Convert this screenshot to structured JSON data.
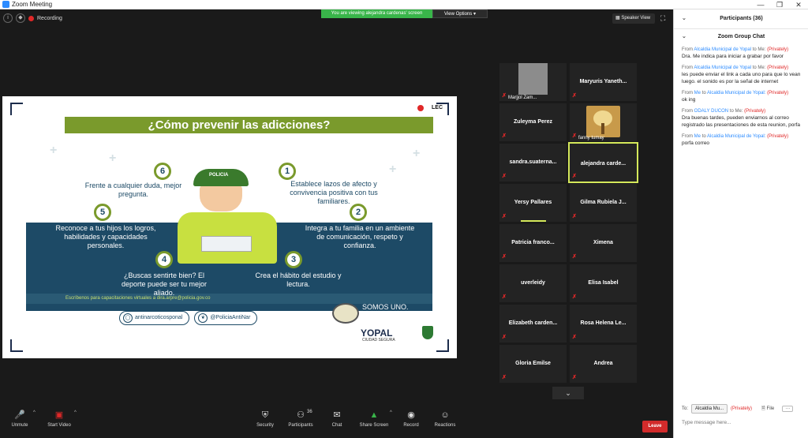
{
  "window": {
    "title": "Zoom Meeting",
    "minimize": "—",
    "maximize": "❐",
    "close": "✕"
  },
  "top_bar": {
    "viewing_banner": "You are viewing alejandra cardenas' screen",
    "view_options": "View Options ▾",
    "recording_label": "Recording",
    "speaker_view": "Speaker View"
  },
  "slide": {
    "brand": "LEC",
    "heading": "¿Cómo prevenir las adicciones?",
    "officer_hat": "POLICIA",
    "steps": [
      {
        "num": "1",
        "text": "Establece lazos de afecto y convivencia positiva con tus familiares."
      },
      {
        "num": "2",
        "text": "Integra a tu familia en un ambiente de comunicación, respeto y confianza."
      },
      {
        "num": "3",
        "text": "Crea el hábito del estudio y lectura."
      },
      {
        "num": "4",
        "text": "¿Buscas sentirte bien? El deporte puede ser tu mejor aliado."
      },
      {
        "num": "5",
        "text": "Reconoce a tus hijos los logros, habilidades y capacidades personales."
      },
      {
        "num": "6",
        "text": "Frente a cualquier duda, mejor pregunta."
      }
    ],
    "contact": "Escríbenos para capacitaciones virtuales a dira.arpre@policia.gov.co",
    "instagram": "antinarcoticosponal",
    "twitter": "@PoliciaAntiNar",
    "slogan_1": "SOMOS UNO.",
    "slogan_2": "SOMOS TODOS.",
    "city": "YOPAL",
    "city_sub": "CIUDAD SEGURA"
  },
  "gallery": {
    "tiles": [
      {
        "name": "Marjjol Zam..."
      },
      {
        "name": "Maryuris Yaneth..."
      },
      {
        "name": "Zuleyma Perez"
      },
      {
        "name": "fanny tumay"
      },
      {
        "name": "sandra.suaterna..."
      },
      {
        "name": "alejandra carde..."
      },
      {
        "name": "Yersy Pallares"
      },
      {
        "name": "Gilma Rubiela J..."
      },
      {
        "name": "Patricia franco..."
      },
      {
        "name": "Ximena"
      },
      {
        "name": "uverleidy"
      },
      {
        "name": "Elisa Isabel"
      },
      {
        "name": "Elizabeth carden..."
      },
      {
        "name": "Rosa Helena Le..."
      },
      {
        "name": "Gloria Emilse"
      },
      {
        "name": "Andrea"
      }
    ]
  },
  "toolbar": {
    "unmute": "Unmute",
    "start_video": "Start Video",
    "security": "Security",
    "participants": "Participants",
    "participants_count": "36",
    "chat": "Chat",
    "share_screen": "Share Screen",
    "record": "Record",
    "reactions": "Reactions",
    "leave": "Leave"
  },
  "panel": {
    "participants_header": "Participants (36)",
    "chat_header": "Zoom Group Chat",
    "messages": [
      {
        "from": "From",
        "sender": "Alcaldia Municipal de Yopal",
        "to": "to",
        "recipient": "Me:",
        "privately": "(Privately)",
        "text": "Dra. Me indica para iniciar a grabar por favor"
      },
      {
        "from": "From",
        "sender": "Alcaldia Municipal de Yopal",
        "to": "to",
        "recipient": "Me:",
        "privately": "(Privately)",
        "text": "les puede enviar el link a cada uno para que lo vean luego. el sonido es por la señal de internet"
      },
      {
        "from": "From",
        "sender": "Me",
        "to": "to",
        "recipient": "Alcaldia Municipal de Yopal:",
        "privately": "(Privately)",
        "text": "ok ing"
      },
      {
        "from": "From",
        "sender": "ODALY DUCON",
        "to": "to",
        "recipient": "Me:",
        "privately": "(Privately)",
        "text": "Dra buenas tardes, pueden enviarnos al correo registrado las presentaciones de esta reunion, porfa"
      },
      {
        "from": "From",
        "sender": "Me",
        "to": "to",
        "recipient": "Alcaldia Municipal de Yopal:",
        "privately": "(Privately)",
        "text": "porfa correo"
      }
    ],
    "to_label": "To:",
    "to_value": "Alcaldia Mu...",
    "to_privately": "(Privately)",
    "file_label": "File",
    "more_label": "···",
    "input_placeholder": "Type message here..."
  }
}
